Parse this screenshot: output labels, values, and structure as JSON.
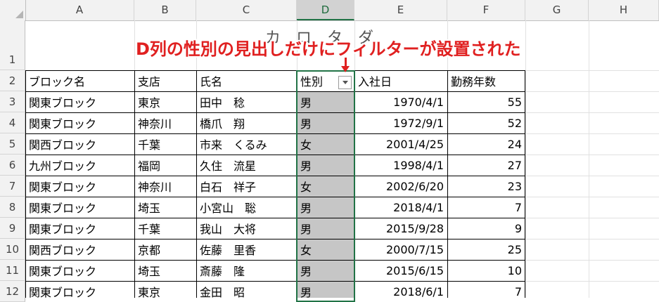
{
  "columns": [
    "A",
    "B",
    "C",
    "D",
    "E",
    "F",
    "G",
    "H"
  ],
  "row_numbers": [
    "1",
    "2",
    "3",
    "4",
    "5",
    "6",
    "7",
    "8",
    "9",
    "10",
    "11",
    "12"
  ],
  "title_text": "カ　ロ　タ　ダ",
  "annotation": "D列の性別の見出しだけにフィルターが設置された",
  "headers": {
    "block": "ブロック名",
    "branch": "支店",
    "name": "氏名",
    "gender": "性別",
    "join_date": "入社日",
    "years": "勤務年数"
  },
  "rows": [
    {
      "block": "関東ブロック",
      "branch": "東京",
      "name": "田中　稔",
      "gender": "男",
      "join_date": "1970/4/1",
      "years": "55"
    },
    {
      "block": "関東ブロック",
      "branch": "神奈川",
      "name": "橋爪　翔",
      "gender": "男",
      "join_date": "1972/9/1",
      "years": "52"
    },
    {
      "block": "関西ブロック",
      "branch": "千葉",
      "name": "市来　くるみ",
      "gender": "女",
      "join_date": "2001/4/25",
      "years": "24"
    },
    {
      "block": "九州ブロック",
      "branch": "福岡",
      "name": "久住　流星",
      "gender": "男",
      "join_date": "1998/4/1",
      "years": "27"
    },
    {
      "block": "関東ブロック",
      "branch": "神奈川",
      "name": "白石　祥子",
      "gender": "女",
      "join_date": "2002/6/20",
      "years": "23"
    },
    {
      "block": "関東ブロック",
      "branch": "埼玉",
      "name": "小宮山　聡",
      "gender": "男",
      "join_date": "2018/4/1",
      "years": "7"
    },
    {
      "block": "関東ブロック",
      "branch": "千葉",
      "name": "我山　大将",
      "gender": "男",
      "join_date": "2015/9/28",
      "years": "9"
    },
    {
      "block": "関西ブロック",
      "branch": "京都",
      "name": "佐藤　里香",
      "gender": "女",
      "join_date": "2000/7/15",
      "years": "25"
    },
    {
      "block": "関東ブロック",
      "branch": "埼玉",
      "name": "斎藤　隆",
      "gender": "男",
      "join_date": "2015/6/15",
      "years": "10"
    },
    {
      "block": "関東ブロック",
      "branch": "東京",
      "name": "金田　昭",
      "gender": "男",
      "join_date": "2018/6/1",
      "years": "7"
    }
  ],
  "colors": {
    "selection_green": "#217346",
    "annotation_red": "#e02020",
    "selected_fill": "#c6c6c6"
  }
}
